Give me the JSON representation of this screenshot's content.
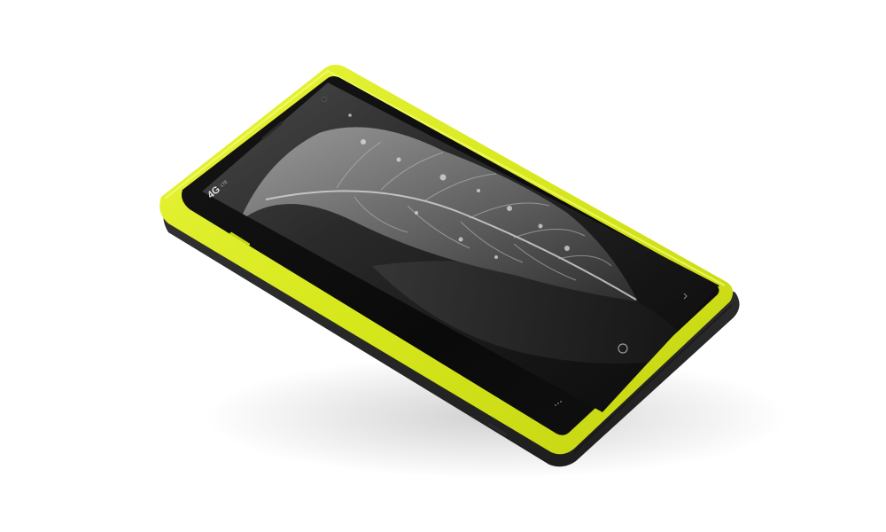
{
  "photo": {
    "subject": "smartphone",
    "body_color": "#d9ea1f",
    "edge_color": "#2d2d2d",
    "screen_color": "#0b0b0b",
    "background_color": "#ffffff"
  },
  "badge": {
    "main": "4G",
    "sub": "LTE"
  },
  "icons": {
    "home": "home-button-icon",
    "menu": "menu-dots-icon",
    "back": "back-chevron-icon",
    "camera": "front-camera-icon"
  }
}
